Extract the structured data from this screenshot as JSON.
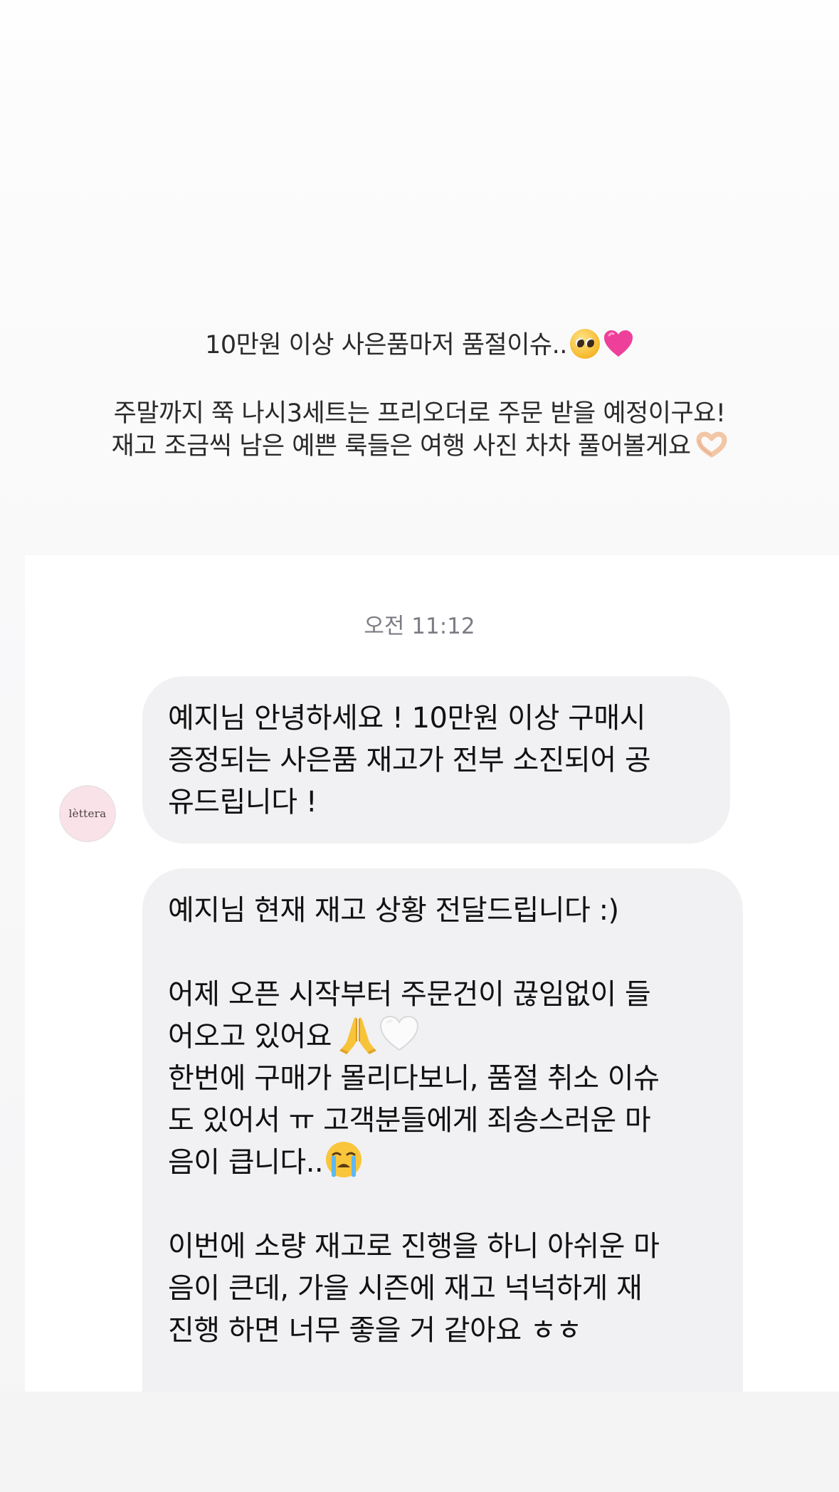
{
  "story_caption": {
    "line1": "10만원 이상 사은품마저 품절이슈..",
    "line2": "주말까지 쭉 나시3세트는 프리오더로 주문 받을 예정이구요!",
    "line3": "재고 조금씩 남은 예쁜 룩들은 여행 사진 차차 풀어볼게요"
  },
  "chat": {
    "timestamp": "오전 11:12",
    "avatar_text": "lèttera",
    "messages": [
      {
        "lines": [
          "예지님 안녕하세요 ! 10만원 이상 구매시",
          "증정되는 사은품 재고가 전부 소진되어 공",
          "유드립니다 !"
        ]
      },
      {
        "lines": [
          "예지님 현재 재고 상황 전달드립니다 :)",
          "",
          "어제 오픈 시작부터 주문건이 끊임없이 들",
          "어오고 있어요",
          "한번에 구매가 몰리다보니, 품절 취소 이슈",
          "도 있어서 ㅠ 고객분들에게 죄송스러운 마",
          "음이 큽니다..",
          "",
          "이번에 소량 재고로 진행을 하니 아쉬운 마",
          "음이 큰데, 가을 시즌에 재고 넉넉하게 재",
          "진행 하면 너무 좋을 거 같아요 ㅎㅎ"
        ]
      }
    ]
  },
  "icons": {
    "caption_line1": [
      "pleading-face-icon",
      "pink-heart-icon"
    ],
    "caption_line3": [
      "heart-hands-icon"
    ],
    "message2_line4": [
      "folded-hands-icon",
      "white-heart-icon"
    ],
    "message2_line7": [
      "crying-face-icon"
    ]
  },
  "colors": {
    "bubble": "#f1f1f3",
    "avatar_bg": "#f9e3e8",
    "timestamp": "#7c7c84"
  }
}
